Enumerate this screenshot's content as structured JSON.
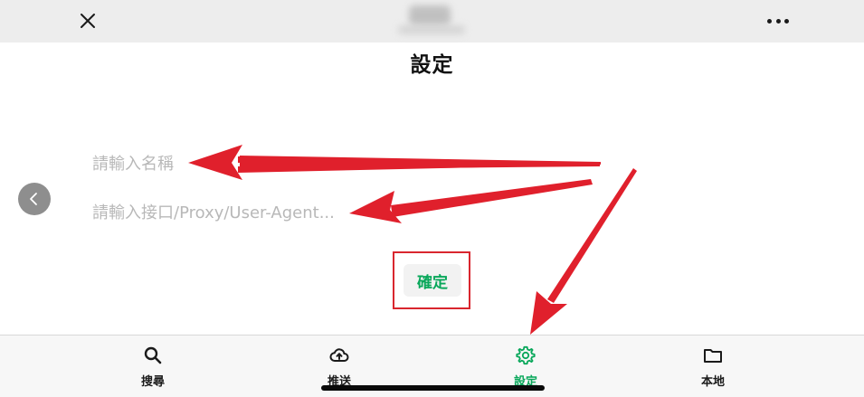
{
  "header": {
    "close_icon": "close-icon",
    "more_icon": "more-horizontal-icon"
  },
  "page": {
    "title": "設定",
    "back_icon": "chevron-left-icon"
  },
  "form": {
    "name_placeholder": "請輸入名稱",
    "name_value": "",
    "api_placeholder": "請輸入接口/Proxy/User-Agent...",
    "api_value": "",
    "confirm_label": "確定"
  },
  "tabs": [
    {
      "label": "搜尋",
      "icon": "search-icon",
      "active": false
    },
    {
      "label": "推送",
      "icon": "cloud-upload-icon",
      "active": false
    },
    {
      "label": "設定",
      "icon": "gear-icon",
      "active": true
    },
    {
      "label": "本地",
      "icon": "folder-icon",
      "active": false
    }
  ],
  "colors": {
    "accent": "#08a75a",
    "annotation": "#e0202c",
    "topbar": "#ededed",
    "tabbar": "#f7f7f7"
  }
}
